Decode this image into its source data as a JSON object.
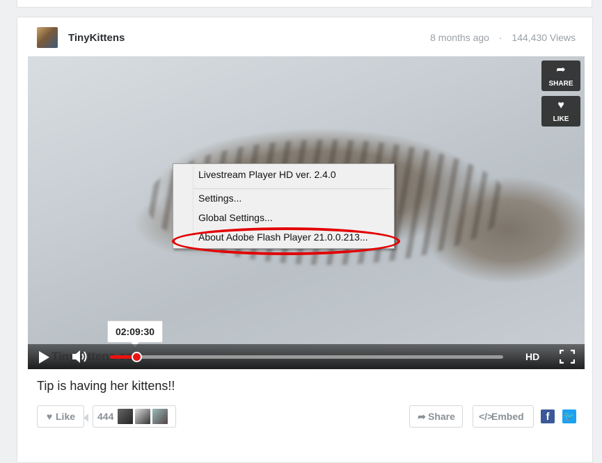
{
  "post": {
    "channel_name": "TinyKittens",
    "posted_ago": "8 months ago",
    "separator": "·",
    "views": "144,430 Views",
    "title": "Tip is having her kittens!!"
  },
  "video": {
    "side_share_label": "SHARE",
    "side_like_label": "LIKE",
    "watermark": "TinyKittens.com",
    "hover_time": "02:09:30",
    "progress_fraction": 0.068,
    "hd_label": "HD"
  },
  "context_menu": {
    "items": [
      "Livestream Player HD ver. 2.4.0",
      "Settings...",
      "Global Settings...",
      "About Adobe Flash Player 21.0.0.213..."
    ],
    "highlight_color": "#e30000"
  },
  "actions": {
    "like_label": "Like",
    "like_count": "444",
    "share_label": "Share",
    "embed_label": "Embed",
    "facebook_icon": "f",
    "twitter_icon": "🐦"
  },
  "colors": {
    "progress": "#e11111",
    "facebook": "#3b5998",
    "twitter": "#1da1f2"
  }
}
